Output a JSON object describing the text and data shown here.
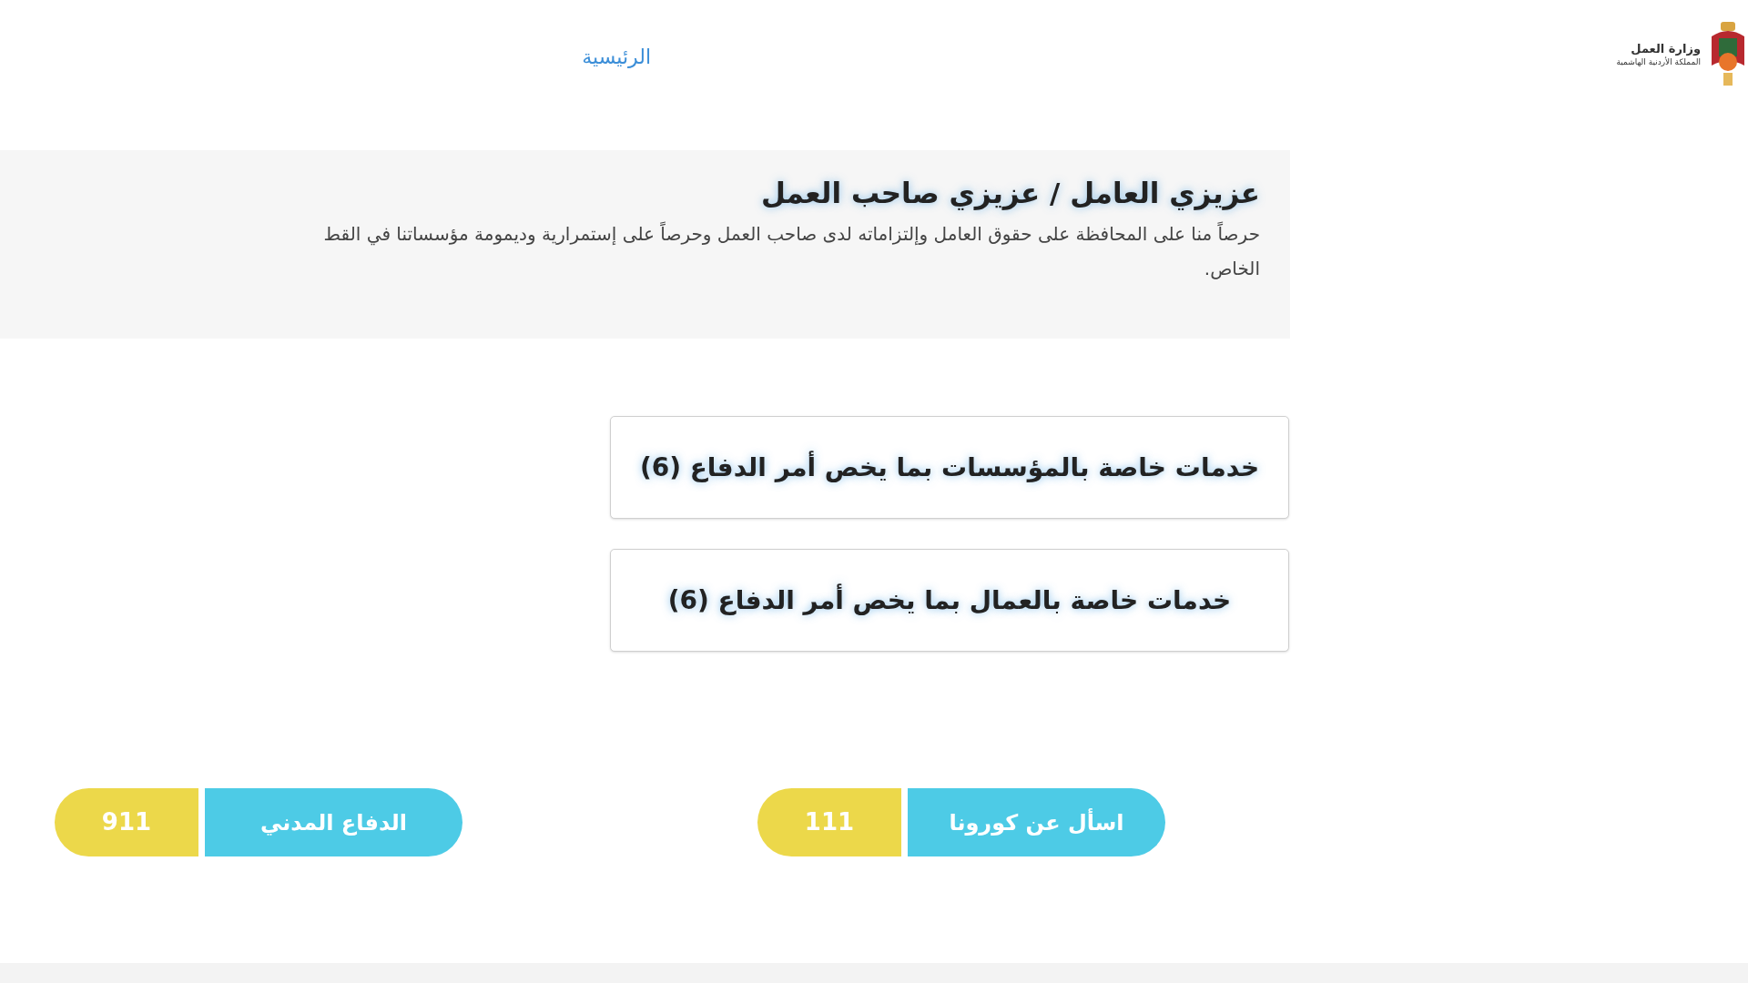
{
  "header": {
    "logo": {
      "name": "وزارة العمل",
      "subtitle": "المملكة الأردنية الهاشمية"
    },
    "nav": [
      {
        "label": "الرئيسية"
      }
    ]
  },
  "intro": {
    "title": "عزيزي العامل / عزيزي صاحب العمل",
    "lines": [
      "حرصاً منا على المحافظة على حقوق العامل وإلتزاماته لدى صاحب العمل وحرصاً على إستمرارية وديمومة مؤسساتنا في القط",
      "الخاص."
    ]
  },
  "services": [
    {
      "label": "خدمات خاصة بالمؤسسات بما يخص أمر الدفاع (6)"
    },
    {
      "label": "خدمات خاصة بالعمال بما يخص أمر الدفاع (6)"
    }
  ],
  "hotlines": [
    {
      "label": "اسأل عن كورونا",
      "number": "111"
    },
    {
      "label": "الدفاع المدني",
      "number": "911"
    }
  ]
}
